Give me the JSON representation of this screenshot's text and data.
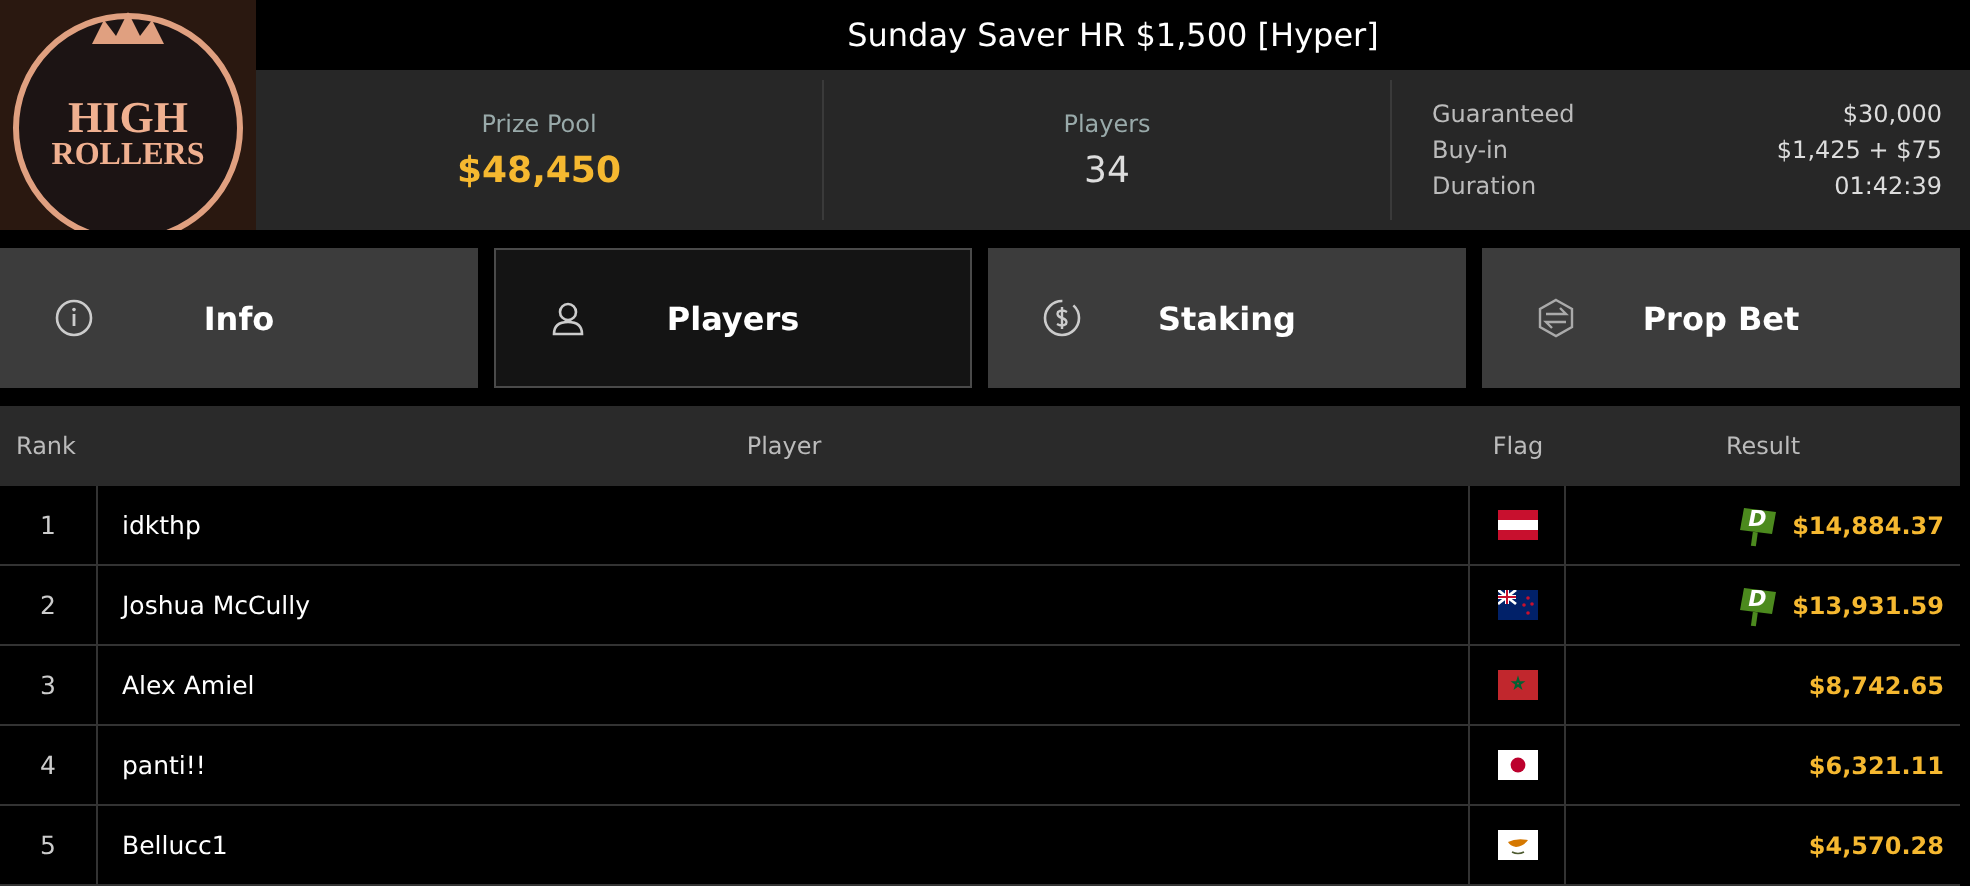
{
  "logo": {
    "line1": "HIGH",
    "line2": "ROLLERS"
  },
  "title": "Sunday Saver HR $1,500 [Hyper]",
  "stats": [
    {
      "label": "Prize Pool",
      "value": "$48,450",
      "kind": "highlight"
    },
    {
      "label": "Players",
      "value": "34",
      "kind": "plain"
    }
  ],
  "details": [
    {
      "label": "Guaranteed",
      "value": "$30,000"
    },
    {
      "label": "Buy-in",
      "value": "$1,425 + $75"
    },
    {
      "label": "Duration",
      "value": "01:42:39"
    }
  ],
  "tabs": [
    {
      "label": "Info",
      "selected": false
    },
    {
      "label": "Players",
      "selected": true
    },
    {
      "label": "Staking",
      "selected": false
    },
    {
      "label": "Prop Bet",
      "selected": false
    }
  ],
  "table": {
    "columns": [
      "Rank",
      "Player",
      "Flag",
      "Result"
    ],
    "rows": [
      {
        "rank": "1",
        "player": "idkthp",
        "kind": "austria",
        "badge": "D",
        "result": "$14,884.37"
      },
      {
        "rank": "2",
        "player": "Joshua McCully",
        "kind": "nz",
        "badge": "D",
        "result": "$13,931.59"
      },
      {
        "rank": "3",
        "player": "Alex Amiel",
        "kind": "morocco",
        "result": "$8,742.65"
      },
      {
        "rank": "4",
        "player": "panti!!",
        "kind": "japan",
        "result": "$6,321.11"
      },
      {
        "rank": "5",
        "player": "Bellucc1",
        "kind": "cyprus",
        "result": "$4,570.28"
      }
    ]
  }
}
